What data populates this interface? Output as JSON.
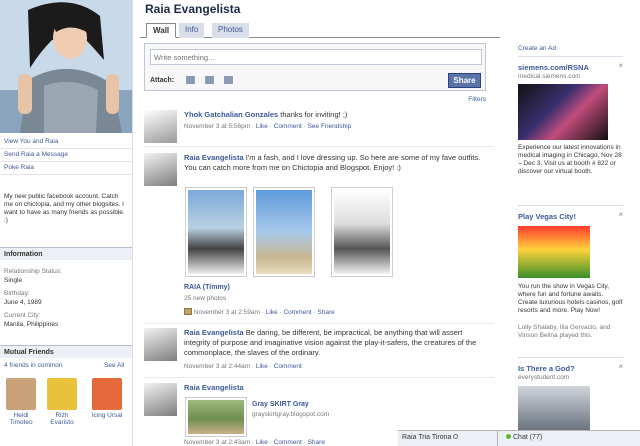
{
  "profile": {
    "name": "Raia Evangelista",
    "links": [
      "View You and Raia",
      "Send Raia a Message",
      "Poke Raia"
    ],
    "bio": "My new public facebook account. Catch me on chictopia, and my other blogsites. I want to have as many friends as possible. :)"
  },
  "information": {
    "header": "Information",
    "fields": [
      {
        "label": "Relationship Status:",
        "value": "Single"
      },
      {
        "label": "Birthday:",
        "value": "June 4, 1989"
      },
      {
        "label": "Current City:",
        "value": "Manila, Philippines"
      }
    ]
  },
  "mutual_friends": {
    "header": "Mutual Friends",
    "count_text": "4 friends in common",
    "see_all": "See All",
    "friends": [
      {
        "name": "Heidi Timoteo",
        "color": "#c9a27a"
      },
      {
        "name": "Rizh Evaristo",
        "color": "#e7c23a"
      },
      {
        "name": "Icing Ursal",
        "color": "#e46a3c"
      }
    ]
  },
  "tabs": [
    "Wall",
    "Info",
    "Photos"
  ],
  "composer": {
    "placeholder": "Write something...",
    "attach_label": "Attach:",
    "share_label": "Share"
  },
  "filters_label": "Filters",
  "stories": [
    {
      "actor": "Yhok Gatchalian Gonzales",
      "text": " thanks for inviting! ;)",
      "time": "November 3 at 5:56pm",
      "actions": [
        "Like",
        "Comment",
        "See Friendship"
      ]
    },
    {
      "actor": "Raia Evangelista",
      "text": " I'm a fash, and I love dressing up. So here are some of my fave outfits. You can catch more from me on Chictopia and Blogspot. Enjoy! :)",
      "album_title": "RAIA (Timmy)",
      "album_count": "25 new photos",
      "time": "November 3 at 2:59am",
      "actions": [
        "Like",
        "Comment",
        "Share"
      ]
    },
    {
      "actor": "Raia Evangelista",
      "text": " Be daring, be different, be impractical, be anything that will assert integrity of purpose and imaginative vision against the play-it-safers, the creatures of the commonplace, the slaves of the ordinary.",
      "time": "November 3 at 2:44am",
      "actions": [
        "Like",
        "Comment"
      ]
    },
    {
      "actor": "Raia Evangelista",
      "link_title": "Gray SKIRT Gray",
      "link_url": "grayskirtgray.blogspot.com",
      "time": "November 3 at 2:43am",
      "actions": [
        "Like",
        "Comment",
        "Share"
      ]
    }
  ],
  "ads": {
    "create_ad": "Create an Ad",
    "items": [
      {
        "title": "siemens.com/RSNA",
        "domain": "medical.siemens.com",
        "body": "Experience our latest innovations in medical imaging in Chicago, Nov 28 – Dec 3. Visit us at booth # 822 or discover our virtual booth."
      },
      {
        "title": "Play Vegas City!",
        "body": "You run the show in Vegas City, where fun and fortune awaits. Create luxurious hotels casinos, golf resorts and more. Play Now!",
        "social": "Lolly Shalaby, Ilia Gervacio, and Vinson Belina played this."
      },
      {
        "title": "Is There a God?",
        "domain": "everystudent.com"
      }
    ],
    "close_glyph": "×"
  },
  "chat": {
    "open_chat_name": "Raia Tria Tirona",
    "online_label": "Chat (77)"
  },
  "colors": {
    "accent": "#3b5998",
    "share_button": "#5b74a8",
    "chat_online": "#5cb82e"
  }
}
